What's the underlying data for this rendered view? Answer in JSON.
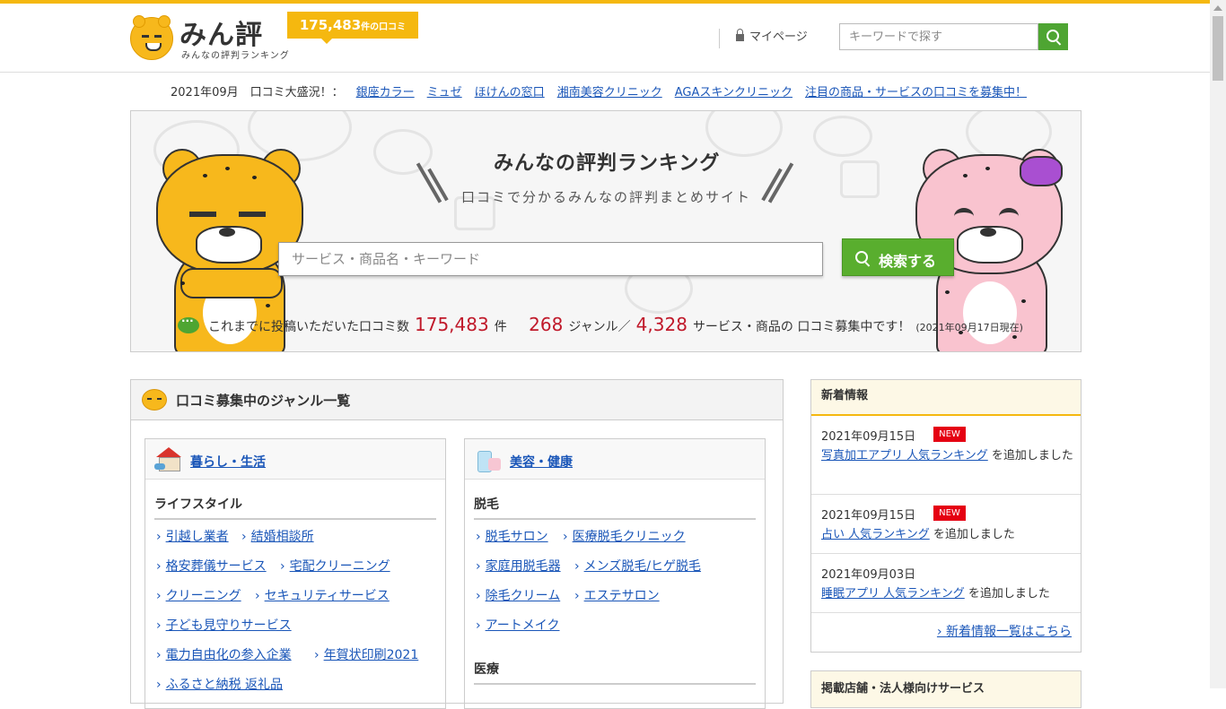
{
  "header": {
    "site_title": "みん評",
    "site_subtitle": "みんなの評判ランキング",
    "review_count": "175,483",
    "review_count_suffix": "件の口コミ",
    "mypage_label": "マイページ",
    "search_placeholder": "キーワードで探す"
  },
  "newsbar": {
    "prefix": "2021年09月　口コミ大盛況！：",
    "links": [
      "銀座カラー",
      "ミュゼ",
      "ほけんの窓口",
      "湘南美容クリニック",
      "AGAスキンクリニック",
      "注目の商品・サービスの口コミを募集中！"
    ]
  },
  "hero": {
    "title": "みんなの評判ランキング",
    "subtitle": "口コミで分かるみんなの評判まとめサイト",
    "search_placeholder": "サービス・商品名・キーワード",
    "search_button": "検索する",
    "stats": {
      "lead": "これまでに投稿いただいた口コミ数",
      "reviews": "175,483",
      "reviews_unit": "件",
      "genres": "268",
      "genres_unit": "ジャンル／",
      "items": "4,328",
      "items_unit": "サービス・商品の",
      "tail": "口コミ募集中です！",
      "as_of": "(2021年09月17日現在)"
    }
  },
  "genre": {
    "title": "口コミ募集中のジャンル一覧",
    "cards": [
      {
        "title": "暮らし・生活",
        "sections": [
          {
            "heading": "ライフスタイル",
            "rows": [
              [
                "引越し業者",
                "結婚相談所"
              ],
              [
                "格安葬儀サービス",
                "宅配クリーニング"
              ],
              [
                "クリーニング",
                "セキュリティサービス"
              ],
              [
                "子ども見守りサービス"
              ],
              [
                "電力自由化の参入企業",
                "年賀状印刷2021"
              ],
              [
                "ふるさと納税 返礼品"
              ]
            ]
          }
        ]
      },
      {
        "title": "美容・健康",
        "sections": [
          {
            "heading": "脱毛",
            "rows": [
              [
                "脱毛サロン",
                "医療脱毛クリニック"
              ],
              [
                "家庭用脱毛器",
                "メンズ脱毛/ヒゲ脱毛"
              ],
              [
                "除毛クリーム",
                "エステサロン"
              ],
              [
                "アートメイク"
              ]
            ]
          },
          {
            "heading": "医療",
            "rows": []
          }
        ]
      }
    ]
  },
  "news": {
    "title": "新着情報",
    "items": [
      {
        "date": "2021年09月15日",
        "badge": "NEW",
        "link": "写真加工アプリ 人気ランキング",
        "text": "を追加しました"
      },
      {
        "date": "2021年09月15日",
        "badge": "NEW",
        "link": "占い 人気ランキング",
        "text": "を追加しました"
      },
      {
        "date": "2021年09月03日",
        "badge": "",
        "link": "睡眠アプリ 人気ランキング",
        "text": "を追加しました"
      }
    ],
    "more": "新着情報一覧はこちら"
  },
  "business": {
    "title": "掲載店舗・法人様向けサービス"
  },
  "colors": {
    "accent": "#f5b80f",
    "search_green": "#4ea532",
    "link_blue": "#1a56b8",
    "stat_red": "#c0192a",
    "new_red": "#e50012"
  }
}
